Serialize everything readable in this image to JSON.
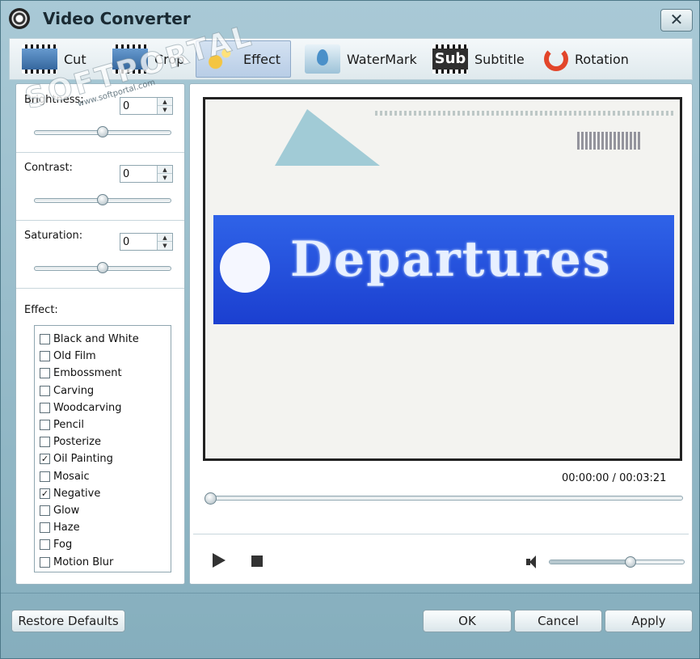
{
  "window": {
    "title": "Video Converter",
    "close_glyph": "✕"
  },
  "toolbar": {
    "tabs": [
      {
        "label": "Cut",
        "icon": "film-cut-icon",
        "active": false
      },
      {
        "label": "Crop",
        "icon": "crop-icon",
        "active": false
      },
      {
        "label": "Effect",
        "icon": "effect-icon",
        "active": true
      },
      {
        "label": "WaterMark",
        "icon": "watermark-icon",
        "active": false
      },
      {
        "label": "Subtitle",
        "icon": "subtitle-icon",
        "active": false
      },
      {
        "label": "Rotation",
        "icon": "rotation-icon",
        "active": false
      }
    ],
    "subtitle_icon_text": "Sub"
  },
  "adjust": {
    "brightness": {
      "label": "Brightness:",
      "value": "0",
      "level": 0.5
    },
    "contrast": {
      "label": "Contrast:",
      "value": "0",
      "level": 0.5
    },
    "saturation": {
      "label": "Saturation:",
      "value": "0",
      "level": 0.5
    }
  },
  "effects": {
    "label": "Effect:",
    "items": [
      {
        "label": "Black and White",
        "checked": false
      },
      {
        "label": "Old Film",
        "checked": false
      },
      {
        "label": "Embossment",
        "checked": false
      },
      {
        "label": "Carving",
        "checked": false
      },
      {
        "label": "Woodcarving",
        "checked": false
      },
      {
        "label": "Pencil",
        "checked": false
      },
      {
        "label": "Posterize",
        "checked": false
      },
      {
        "label": "Oil Painting",
        "checked": true
      },
      {
        "label": "Mosaic",
        "checked": false
      },
      {
        "label": "Negative",
        "checked": true
      },
      {
        "label": "Glow",
        "checked": false
      },
      {
        "label": "Haze",
        "checked": false
      },
      {
        "label": "Fog",
        "checked": false
      },
      {
        "label": "Motion Blur",
        "checked": false
      }
    ]
  },
  "preview": {
    "banner_text": "Departures",
    "current_time": "00:00:00",
    "separator": "/",
    "total_time": "00:03:21",
    "seek_position": 0,
    "volume_level": 0.6
  },
  "buttons": {
    "restore": "Restore Defaults",
    "ok": "OK",
    "cancel": "Cancel",
    "apply": "Apply"
  },
  "watermark": {
    "text": "SOFTPORTAL",
    "url": "www.softportal.com"
  },
  "colors": {
    "window_bg": "#a9c9d6",
    "banner_blue": "#2f63e8",
    "active_tab": "#c6d8ee"
  }
}
